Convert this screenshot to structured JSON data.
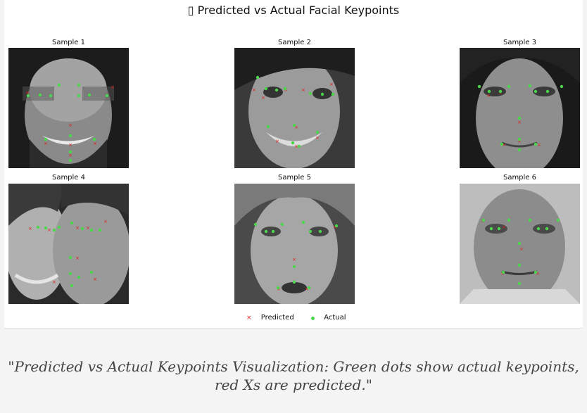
{
  "figure": {
    "title": "▯ Predicted vs Actual Facial Keypoints"
  },
  "samples": [
    {
      "label": "Sample 1",
      "face_icon": "bearded-smiling-man-face-photo"
    },
    {
      "label": "Sample 2",
      "face_icon": "smiling-woman-face-photo"
    },
    {
      "label": "Sample 3",
      "face_icon": "woman-neutral-face-photo"
    },
    {
      "label": "Sample 4",
      "face_icon": "couple-faces-photo"
    },
    {
      "label": "Sample 5",
      "face_icon": "young-woman-face-photo"
    },
    {
      "label": "Sample 6",
      "face_icon": "man-face-photo"
    }
  ],
  "legend": {
    "predicted_label": "Predicted",
    "actual_label": "Actual",
    "predicted_color": "#e0201c",
    "actual_color": "#4cd64c"
  },
  "caption": "\"Predicted vs Actual Keypoints Visualization: Green dots show actual keypoints, red Xs are predicted.\""
}
